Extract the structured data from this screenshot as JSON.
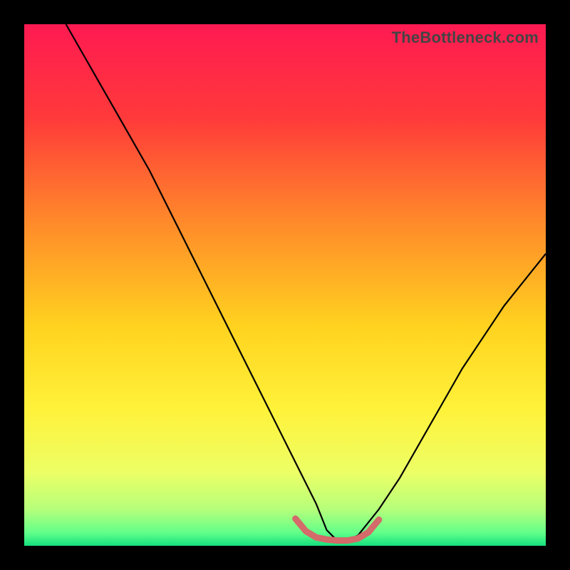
{
  "watermark": {
    "text": "TheBottleneck.com"
  },
  "gradient": {
    "stops": [
      {
        "offset": 0.0,
        "color": "#ff1a52"
      },
      {
        "offset": 0.18,
        "color": "#ff3a3a"
      },
      {
        "offset": 0.38,
        "color": "#ff8a2a"
      },
      {
        "offset": 0.58,
        "color": "#ffd31f"
      },
      {
        "offset": 0.74,
        "color": "#fff23a"
      },
      {
        "offset": 0.86,
        "color": "#ecff66"
      },
      {
        "offset": 0.93,
        "color": "#b6ff7a"
      },
      {
        "offset": 0.975,
        "color": "#62ff8a"
      },
      {
        "offset": 1.0,
        "color": "#14e07e"
      }
    ]
  },
  "chart_data": {
    "type": "line",
    "title": "",
    "xlabel": "",
    "ylabel": "",
    "xlim": [
      0,
      100
    ],
    "ylim": [
      0,
      100
    ],
    "grid": false,
    "legend": false,
    "series": [
      {
        "name": "bottleneck-curve",
        "color": "#000000",
        "width": 2.2,
        "x": [
          8,
          12,
          16,
          20,
          24,
          28,
          32,
          36,
          40,
          44,
          48,
          52,
          56,
          58,
          60,
          62,
          64,
          68,
          72,
          76,
          80,
          84,
          88,
          92,
          96,
          100
        ],
        "y": [
          100,
          93,
          86,
          79,
          72,
          64,
          56,
          48,
          40,
          32,
          24,
          16,
          8,
          3,
          1,
          1,
          2,
          7,
          13,
          20,
          27,
          34,
          40,
          46,
          51,
          56
        ]
      },
      {
        "name": "optimal-zone",
        "color": "#d46a6a",
        "width": 9,
        "linecap": "round",
        "x": [
          52,
          54,
          56,
          58,
          60,
          62,
          64,
          66,
          68
        ],
        "y": [
          5.2,
          2.8,
          1.6,
          1.2,
          1.0,
          1.0,
          1.4,
          2.6,
          5.0
        ]
      }
    ]
  }
}
